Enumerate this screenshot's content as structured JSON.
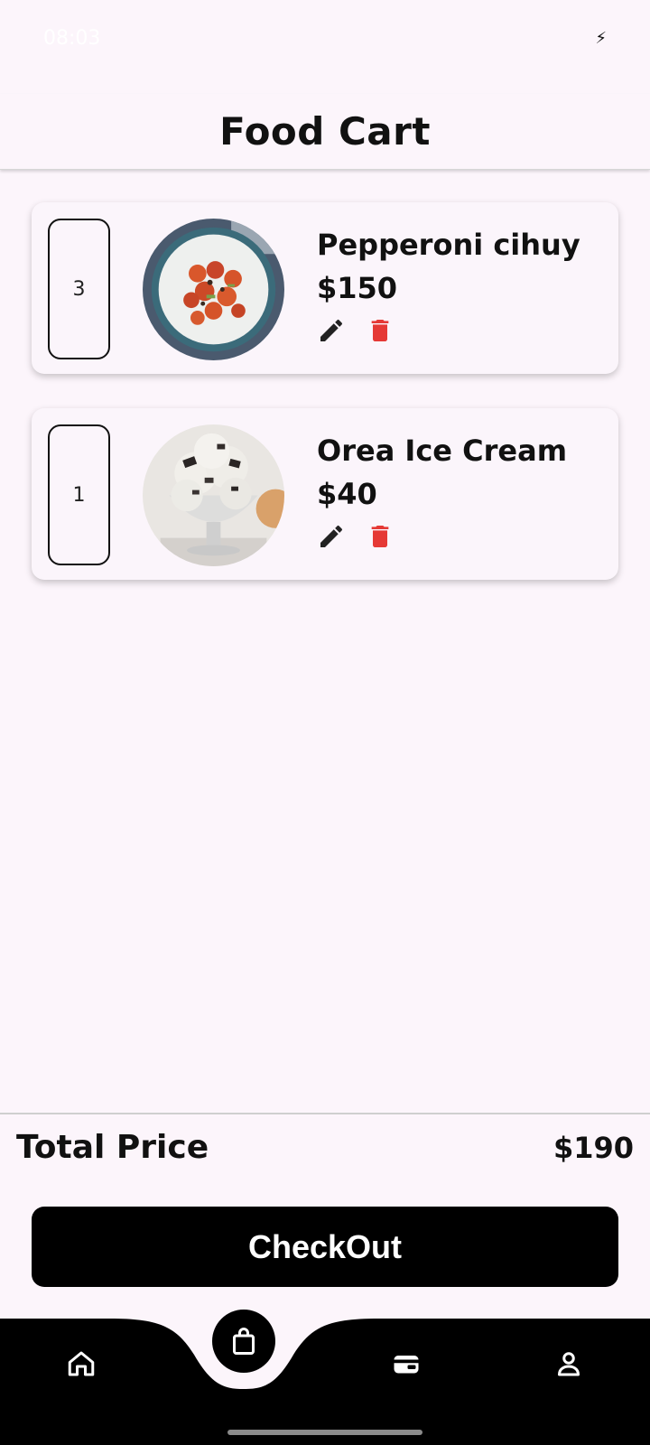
{
  "status_bar": {
    "time": "08:03"
  },
  "header": {
    "title": "Food Cart"
  },
  "cart": {
    "items": [
      {
        "quantity": "3",
        "name": "Pepperoni cihuy",
        "price": "$150",
        "image": "rice-bowl-photo"
      },
      {
        "quantity": "1",
        "name": "Orea Ice Cream",
        "price": "$40",
        "image": "ice-cream-photo"
      }
    ]
  },
  "summary": {
    "total_label": "Total Price",
    "total_value": "$190"
  },
  "checkout": {
    "label": "CheckOut"
  },
  "nav": {
    "items": [
      "home-icon",
      "shopping-bag-icon",
      "wallet-icon",
      "profile-icon"
    ]
  },
  "colors": {
    "delete": "#e53935",
    "edit": "#222222",
    "nav_bg": "#000000",
    "page_bg": "#fcf5fb"
  }
}
